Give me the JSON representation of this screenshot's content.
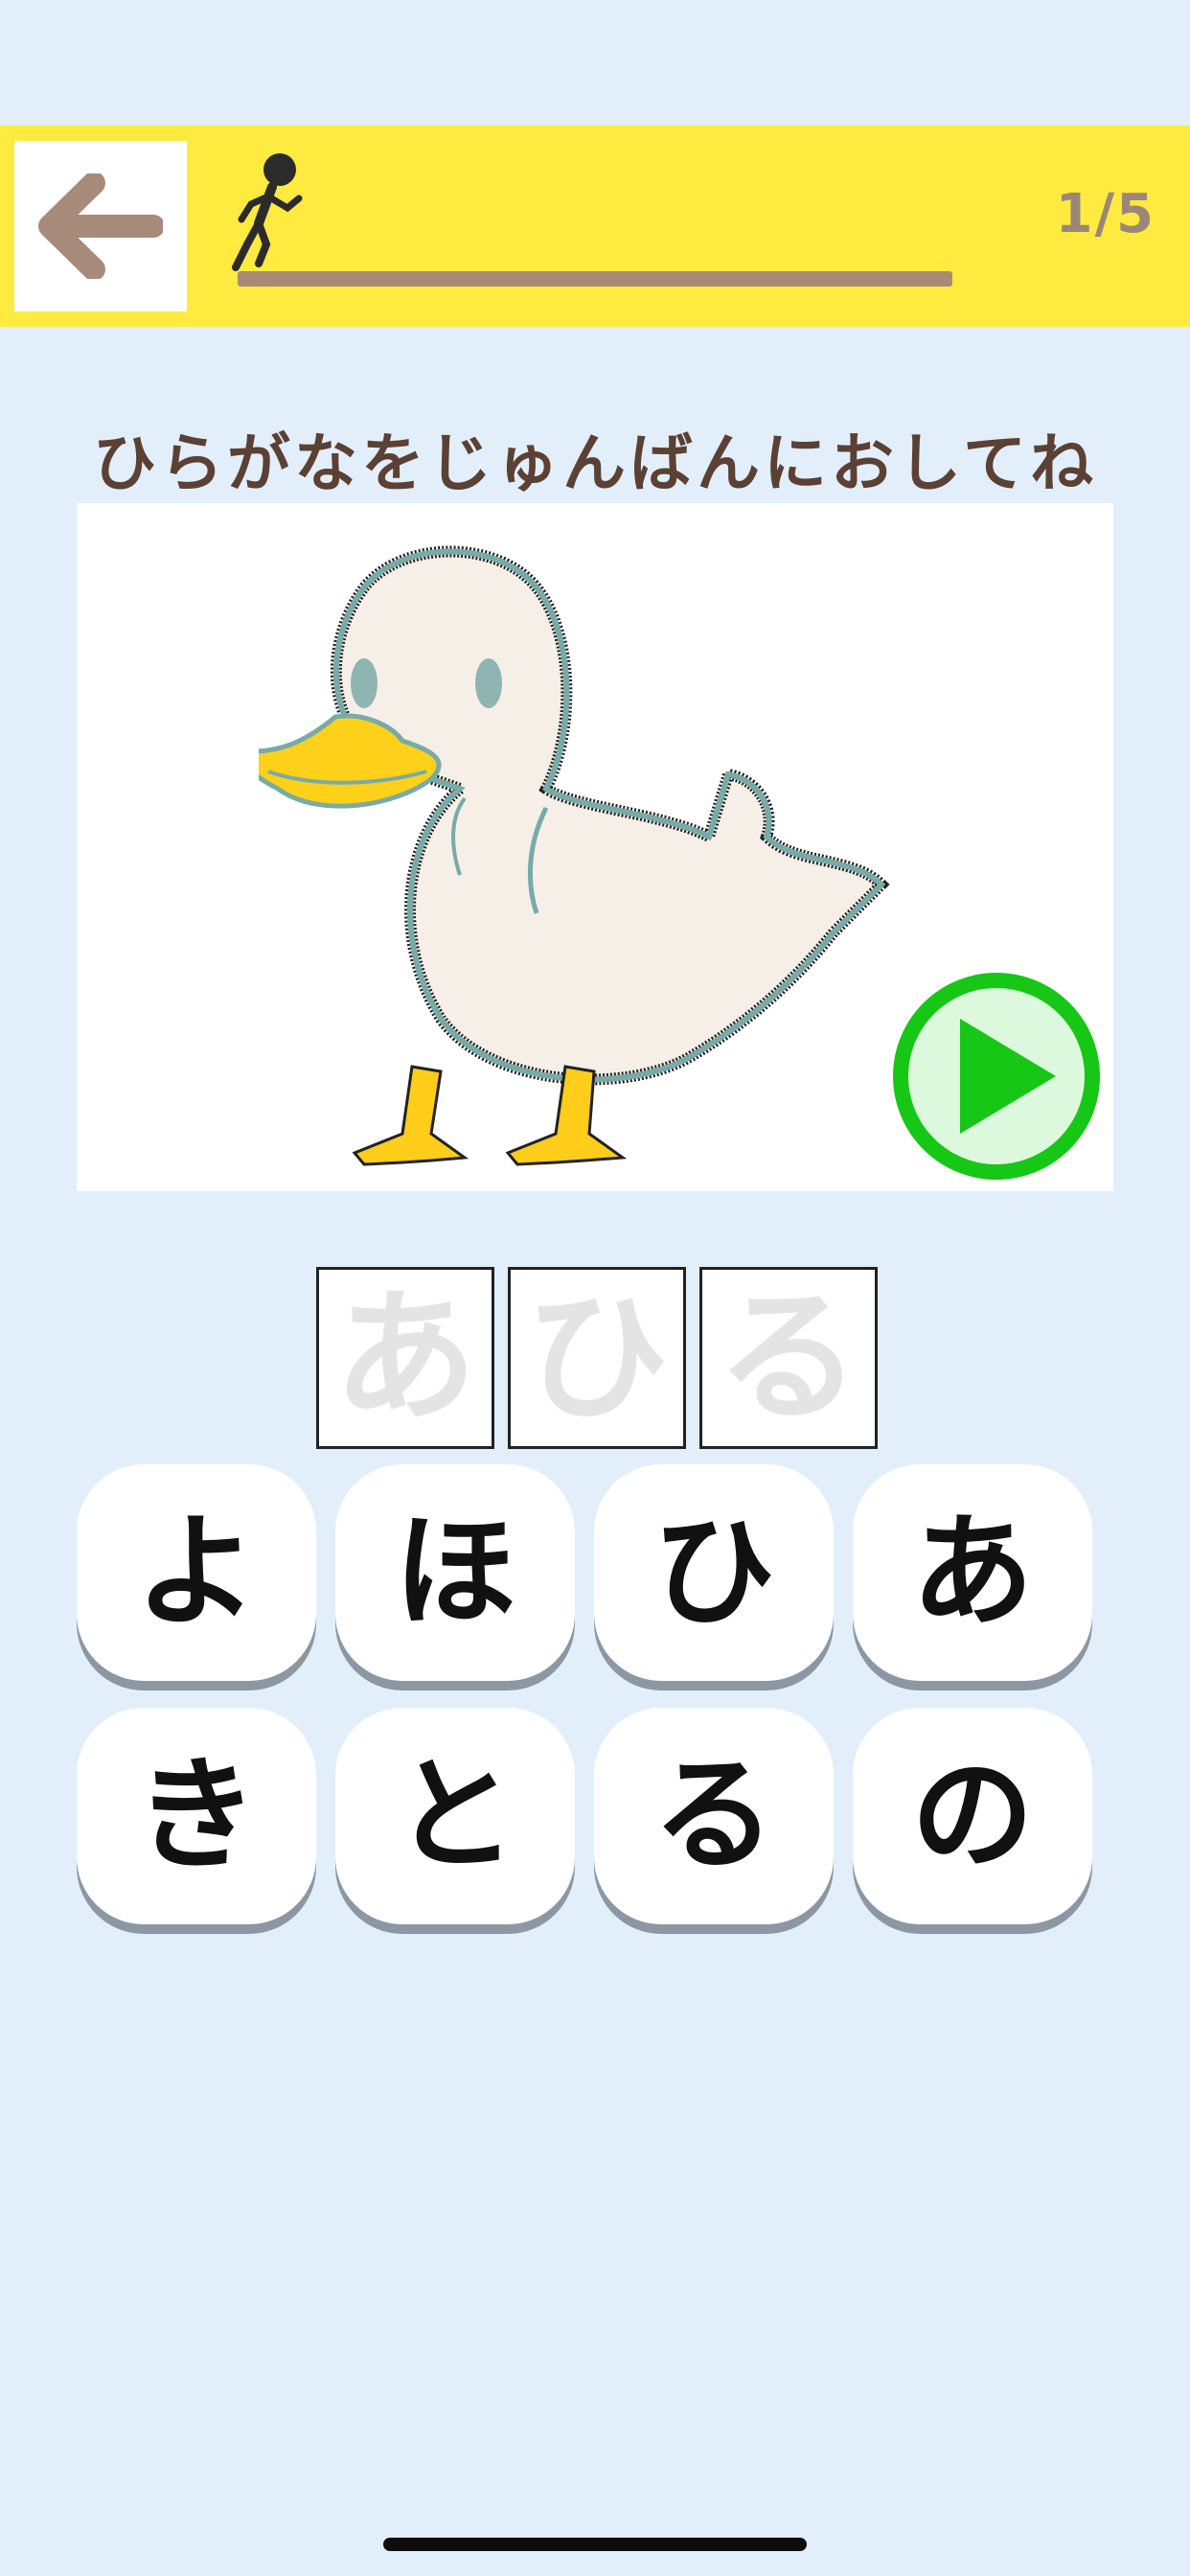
{
  "header": {
    "back_icon": "arrow-left-icon",
    "runner_icon": "running-figure-icon",
    "progress_text": "1/5",
    "progress_fraction": 0.2
  },
  "instruction": "ひらがなをじゅんばんにおしてね",
  "picture": {
    "subject_icon": "duck-illustration",
    "play_icon": "play-icon"
  },
  "answer_slots": [
    "あ",
    "ひ",
    "る"
  ],
  "keys": [
    "よ",
    "ほ",
    "ひ",
    "あ",
    "き",
    "と",
    "る",
    "の"
  ],
  "colors": {
    "background": "#e2effa",
    "header": "#ffea3f",
    "back_arrow": "#a88a7a",
    "progress_track": "#a98b75",
    "instruction_text": "#5b4034",
    "play_button": "#1ec81e",
    "key_shadow": "#8c97a4"
  }
}
